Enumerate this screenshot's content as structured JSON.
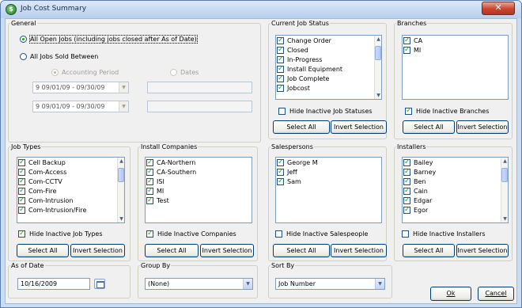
{
  "window": {
    "title": "Job Cost Summary",
    "close_glyph": "✕"
  },
  "general": {
    "legend": "General",
    "opt_all_open": "All Open Jobs (including jobs closed after As of Date)",
    "opt_sold_between": "All Jobs Sold Between",
    "opt_accounting_period": "Accounting Period",
    "opt_dates": "Dates",
    "period_from": "9   09/01/09 - 09/30/09",
    "period_to": "9   09/01/09 - 09/30/09"
  },
  "job_status": {
    "legend": "Current Job Status",
    "items": [
      "Change Order",
      "Closed",
      "In-Progress",
      "Install Equipment",
      "Job Complete",
      "Jobcost"
    ],
    "hide_inactive": "Hide Inactive Job Statuses",
    "select_all": "Select All",
    "invert": "Invert Selection"
  },
  "branches": {
    "legend": "Branches",
    "items": [
      "CA",
      "MI"
    ],
    "hide_inactive": "Hide Inactive Branches",
    "select_all": "Select All",
    "invert": "Invert Selection"
  },
  "job_types": {
    "legend": "Job Types",
    "items": [
      "Cell Backup",
      "Com-Access",
      "Com-CCTV",
      "Com-Fire",
      "Com-Intrusion",
      "Com-Intrusion/Fire"
    ],
    "hide_inactive": "Hide Inactive Job Types",
    "select_all": "Select All",
    "invert": "Invert Selection"
  },
  "install_companies": {
    "legend": "Install Companies",
    "items": [
      "CA-Northern",
      "CA-Southern",
      "ISI",
      "MI",
      "Test"
    ],
    "hide_inactive": "Hide Inactive Companies",
    "select_all": "Select All",
    "invert": "Invert Selection"
  },
  "salespersons": {
    "legend": "Salespersons",
    "items": [
      "George M",
      "Jeff",
      "Sam"
    ],
    "hide_inactive": "Hide Inactive Salespeople",
    "select_all": "Select All",
    "invert": "Invert Selection"
  },
  "installers": {
    "legend": "Installers",
    "items": [
      "Bailey",
      "Barney",
      "Ben",
      "Cain",
      "Edgar",
      "Egor"
    ],
    "hide_inactive": "Hide Inactive Installers",
    "select_all": "Select All",
    "invert": "Invert Selection"
  },
  "as_of_date": {
    "legend": "As of Date",
    "value": "10/16/2009"
  },
  "group_by": {
    "legend": "Group By",
    "value": "(None)"
  },
  "sort_by": {
    "legend": "Sort By",
    "value": "Job Number"
  },
  "footer": {
    "ok": "Ok",
    "cancel": "Cancel"
  }
}
